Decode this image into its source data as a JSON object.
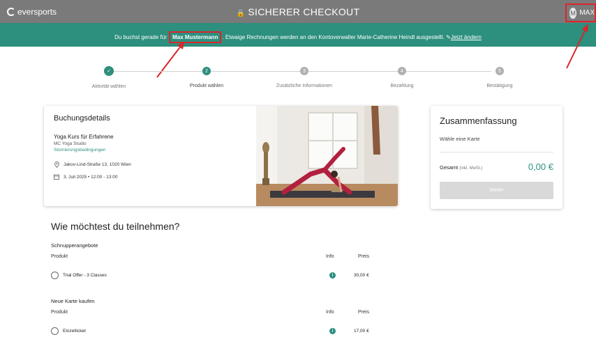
{
  "header": {
    "brand": "eversports",
    "title": "SICHERER CHECKOUT",
    "user_initial": "M",
    "user_name": "MAX"
  },
  "banner": {
    "text_before": "Du buchst gerade für",
    "name": "Max Mustermann",
    "text_after": ". Etwaige Rechnungen werden an den Kontoverwalter Marie-Catherine Heindl ausgestellt.",
    "link": "Jetzt ändern"
  },
  "steps": [
    {
      "label": "Aktivität wählen",
      "state": "done",
      "num": "✓"
    },
    {
      "label": "Produkt wählen",
      "state": "active",
      "num": "2"
    },
    {
      "label": "Zusätzliche Informationen",
      "state": "pending",
      "num": "3"
    },
    {
      "label": "Bezahlung",
      "state": "pending",
      "num": "4"
    },
    {
      "label": "Bestätigung",
      "state": "pending",
      "num": "5"
    }
  ],
  "booking": {
    "title": "Buchungsdetails",
    "course": "Yoga Kurs für Erfahrene",
    "studio": "MC Yoga Studio",
    "cancel_link": "Stornierungsbedingungen",
    "address": "Jakov-Lind-Straße 13, 1020 Wien",
    "datetime": "3. Juli 2025 • 12:00 - 13:00"
  },
  "summary": {
    "title": "Zusammenfassung",
    "subtitle": "Wähle eine Karte",
    "total_label": "Gesamt",
    "total_note": "(inkl. MwSt.)",
    "total_amount": "0,00 €",
    "button": "Weiter"
  },
  "question": "Wie möchtest du teilnehmen?",
  "sections": [
    {
      "title": "Schnupperangebote",
      "col_product": "Produkt",
      "col_info": "Info",
      "col_price": "Preis",
      "item": {
        "name": "Trial Offer - 3 Classes",
        "price": "30,00 €"
      }
    },
    {
      "title": "Neue Karte kaufen",
      "col_product": "Produkt",
      "col_info": "Info",
      "col_price": "Preis",
      "item": {
        "name": "Einzelticket",
        "price": "17,00 €"
      }
    }
  ],
  "colors": {
    "accent": "#2d8f7e",
    "topbar": "#7a7a7a",
    "highlight": "#d9262a"
  }
}
